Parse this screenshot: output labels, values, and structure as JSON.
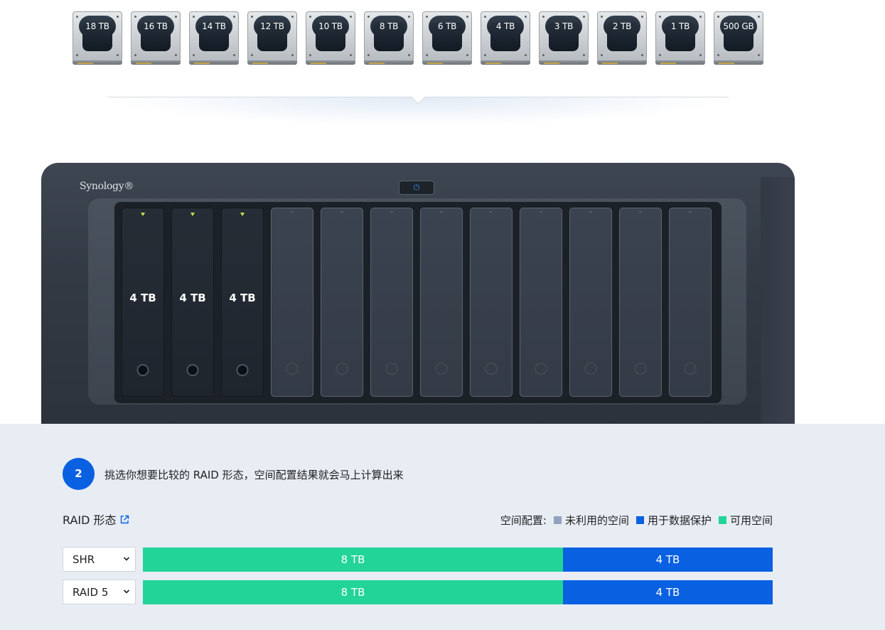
{
  "drives": [
    "18 TB",
    "16 TB",
    "14 TB",
    "12 TB",
    "10 TB",
    "8 TB",
    "6 TB",
    "4 TB",
    "3 TB",
    "2 TB",
    "1 TB",
    "500 GB"
  ],
  "nas": {
    "brand": "Synology®",
    "power_symbol": "⏻",
    "bays": [
      {
        "filled": true,
        "label": "4 TB"
      },
      {
        "filled": true,
        "label": "4 TB"
      },
      {
        "filled": true,
        "label": "4 TB"
      },
      {
        "filled": false
      },
      {
        "filled": false
      },
      {
        "filled": false
      },
      {
        "filled": false
      },
      {
        "filled": false
      },
      {
        "filled": false
      },
      {
        "filled": false
      },
      {
        "filled": false
      },
      {
        "filled": false
      }
    ]
  },
  "step": {
    "number": "2",
    "text": "挑选你想要比较的 RAID 形态，空间配置结果就会马上计算出来"
  },
  "raid": {
    "title": "RAID 形态"
  },
  "legend": {
    "title": "空间配置:",
    "items": [
      {
        "label": "未利用的空间",
        "color": "#8fa3bd"
      },
      {
        "label": "用于数据保护",
        "color": "#0960e1"
      },
      {
        "label": "可用空间",
        "color": "#22d497"
      }
    ]
  },
  "rows": [
    {
      "select": "SHR",
      "segments": [
        {
          "label": "8 TB",
          "fraction": 0.667,
          "color": "#22d497"
        },
        {
          "label": "4 TB",
          "fraction": 0.333,
          "color": "#0960e1"
        }
      ]
    },
    {
      "select": "RAID 5",
      "segments": [
        {
          "label": "8 TB",
          "fraction": 0.667,
          "color": "#22d497"
        },
        {
          "label": "4 TB",
          "fraction": 0.333,
          "color": "#0960e1"
        }
      ]
    }
  ]
}
